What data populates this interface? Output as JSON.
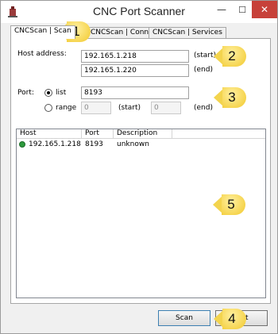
{
  "window": {
    "title": "CNC Port Scanner",
    "minimize_glyph": "—",
    "maximize_glyph": "☐",
    "close_glyph": "✕"
  },
  "tabs": [
    {
      "label": "CNCScan | Scan",
      "active": true
    },
    {
      "label": "CNCScan | Connect",
      "active": false
    },
    {
      "label": "CNCScan | Services",
      "active": false
    }
  ],
  "host": {
    "label": "Host address:",
    "start_value": "192.165.1.218",
    "start_suffix": "(start)",
    "end_value": "192.165.1.220",
    "end_suffix": "(end)"
  },
  "port": {
    "label": "Port:",
    "list_label": "list",
    "list_selected": true,
    "list_value": "8193",
    "range_label": "range",
    "range_start_value": "0",
    "range_start_suffix": "(start)",
    "range_end_value": "0",
    "range_end_suffix": "(end)"
  },
  "results": {
    "columns": [
      "Host",
      "Port",
      "Description"
    ],
    "rows": [
      {
        "host": "192.165.1.218",
        "port": "8193",
        "description": "unknown",
        "status": "open"
      }
    ]
  },
  "buttons": {
    "scan_label": "Scan",
    "exit_label": "Exit"
  },
  "callouts": [
    "1",
    "2",
    "3",
    "4",
    "5"
  ],
  "colors": {
    "callout": "#f2c92d",
    "close_button": "#c7413a",
    "status_ok": "#2d9a3c"
  }
}
